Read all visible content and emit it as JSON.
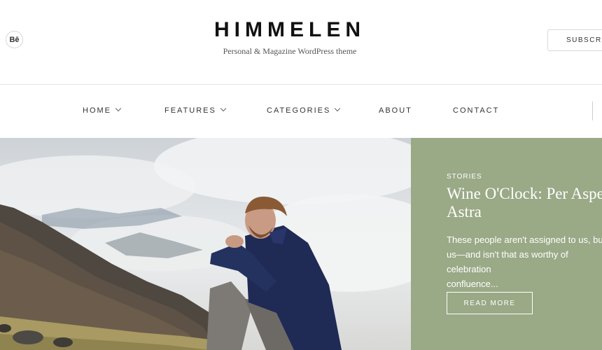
{
  "header": {
    "social_icon_label": "Bē",
    "site_title": "HIMMELEN",
    "tagline": "Personal & Magazine WordPress theme",
    "subscribe_label": "SUBSCRIBE"
  },
  "nav": {
    "items": [
      {
        "label": "HOME",
        "has_dropdown": true
      },
      {
        "label": "FEATURES",
        "has_dropdown": true
      },
      {
        "label": "CATEGORIES",
        "has_dropdown": true
      },
      {
        "label": "ABOUT",
        "has_dropdown": false
      },
      {
        "label": "CONTACT",
        "has_dropdown": false
      }
    ]
  },
  "hero": {
    "category": "STORIES",
    "title": "Wine O'Clock: Per Aspera Ad\nAstra",
    "excerpt": "These people aren't assigned to us, but\nus—and isn't that as worthy of celebration\nconfluence...",
    "read_more_label": "READ MORE",
    "panel_color": "#9aa986"
  }
}
